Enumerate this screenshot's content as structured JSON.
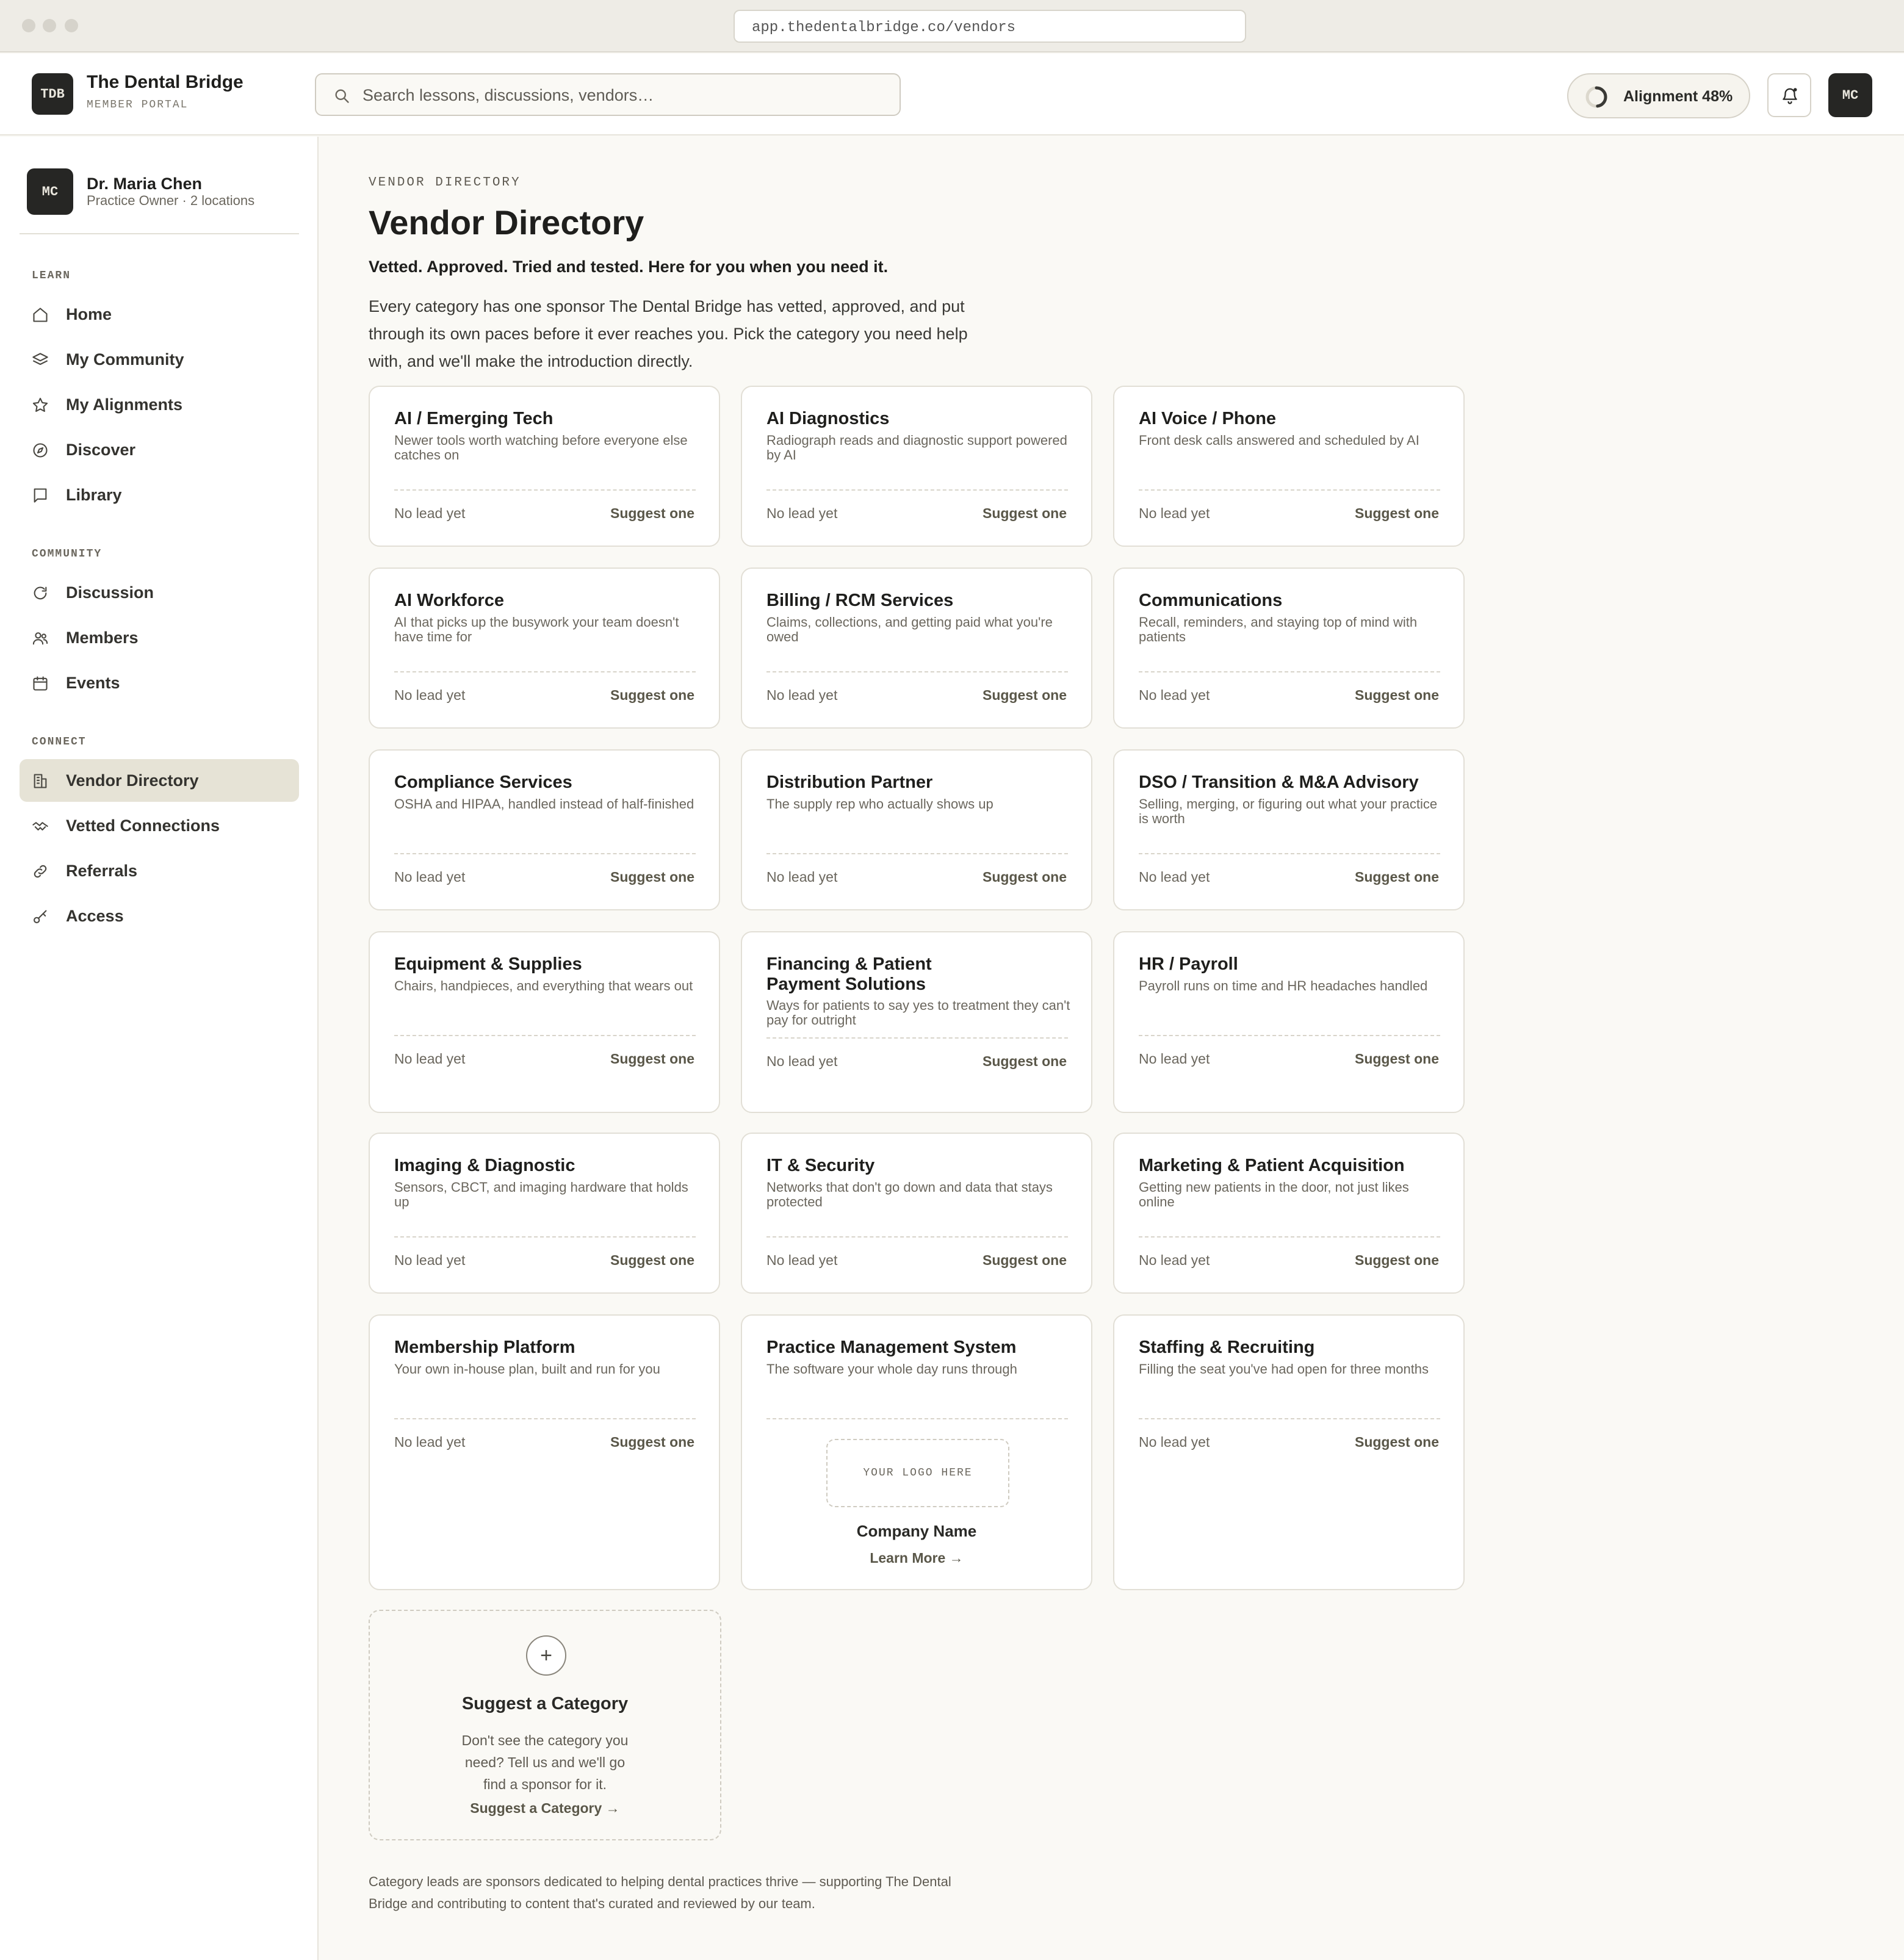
{
  "browser": {
    "url": "app.thedentalbridge.co/vendors"
  },
  "header": {
    "logo": "TDB",
    "brand": "The Dental Bridge",
    "subtitle": "MEMBER PORTAL",
    "search_placeholder": "Search lessons, discussions, vendors…",
    "alignment_label": "Alignment 48%",
    "alignment_progress": 0.48,
    "avatar": "MC"
  },
  "sidebar": {
    "profile": {
      "avatar": "MC",
      "name": "Dr. Maria Chen",
      "role": "Practice Owner · 2 locations"
    },
    "sections": [
      {
        "label": "LEARN",
        "items": [
          {
            "label": "Home",
            "icon": "home-icon"
          },
          {
            "label": "My Community",
            "icon": "layers-icon"
          },
          {
            "label": "My Alignments",
            "icon": "star-icon"
          },
          {
            "label": "Discover",
            "icon": "compass-icon"
          },
          {
            "label": "Library",
            "icon": "book-icon"
          }
        ]
      },
      {
        "label": "COMMUNITY",
        "items": [
          {
            "label": "Discussion",
            "icon": "refresh-icon"
          },
          {
            "label": "Members",
            "icon": "users-icon"
          },
          {
            "label": "Events",
            "icon": "calendar-icon"
          }
        ]
      },
      {
        "label": "CONNECT",
        "items": [
          {
            "label": "Vendor Directory",
            "icon": "building-icon",
            "active": true
          },
          {
            "label": "Vetted Connections",
            "icon": "handshake-icon"
          },
          {
            "label": "Referrals",
            "icon": "link-icon"
          },
          {
            "label": "Access",
            "icon": "key-icon"
          }
        ]
      }
    ]
  },
  "main": {
    "eyebrow": "VENDOR DIRECTORY",
    "title": "Vendor Directory",
    "tagline": "Vetted. Approved. Tried and tested. Here for you when you need it.",
    "intro": "Every category has one sponsor The Dental Bridge has vetted, approved, and put through its own paces before it ever reaches you. Pick the category you need help with, and we'll make the introduction directly.",
    "no_lead": "No lead yet",
    "suggest_one": "Suggest one",
    "categories": [
      {
        "title": "AI / Emerging Tech",
        "desc": "Newer tools worth watching before everyone else catches on"
      },
      {
        "title": "AI Diagnostics",
        "desc": "Radiograph reads and diagnostic support powered by AI"
      },
      {
        "title": "AI Voice / Phone",
        "desc": "Front desk calls answered and scheduled by AI"
      },
      {
        "title": "AI Workforce",
        "desc": "AI that picks up the busywork your team doesn't have time for"
      },
      {
        "title": "Billing / RCM Services",
        "desc": "Claims, collections, and getting paid what you're owed"
      },
      {
        "title": "Communications",
        "desc": "Recall, reminders, and staying top of mind with patients"
      },
      {
        "title": "Compliance Services",
        "desc": "OSHA and HIPAA, handled instead of half-finished"
      },
      {
        "title": "Distribution Partner",
        "desc": "The supply rep who actually shows up"
      },
      {
        "title": "DSO / Transition & M&A Advisory",
        "desc": "Selling, merging, or figuring out what your practice is worth"
      },
      {
        "title": "Equipment & Supplies",
        "desc": "Chairs, handpieces, and everything that wears out"
      },
      {
        "title": "Financing & Patient Payment Solutions",
        "desc": "Ways for patients to say yes to treatment they can't pay for outright"
      },
      {
        "title": "HR / Payroll",
        "desc": "Payroll runs on time and HR headaches handled"
      },
      {
        "title": "Imaging & Diagnostic",
        "desc": "Sensors, CBCT, and imaging hardware that holds up"
      },
      {
        "title": "IT & Security",
        "desc": "Networks that don't go down and data that stays protected"
      },
      {
        "title": "Marketing & Patient Acquisition",
        "desc": "Getting new patients in the door, not just likes online"
      },
      {
        "title": "Membership Platform",
        "desc": "Your own in-house plan, built and run for you"
      },
      {
        "title": "Practice Management System",
        "desc": "The software your whole day runs through",
        "sponsor": {
          "logo": "YOUR LOGO HERE",
          "company": "Company Name",
          "link": "Learn More →"
        }
      },
      {
        "title": "Staffing & Recruiting",
        "desc": "Filling the seat you've had open for three months"
      }
    ],
    "suggest_card": {
      "plus": "+",
      "title": "Suggest a Category",
      "desc": "Don't see the category you need? Tell us and we'll go find a sponsor for it.",
      "link": "Suggest a Category →"
    },
    "footnote": "Category leads are sponsors dedicated to helping dental practices thrive — supporting The Dental Bridge and contributing to content that's curated and reviewed by our team."
  }
}
